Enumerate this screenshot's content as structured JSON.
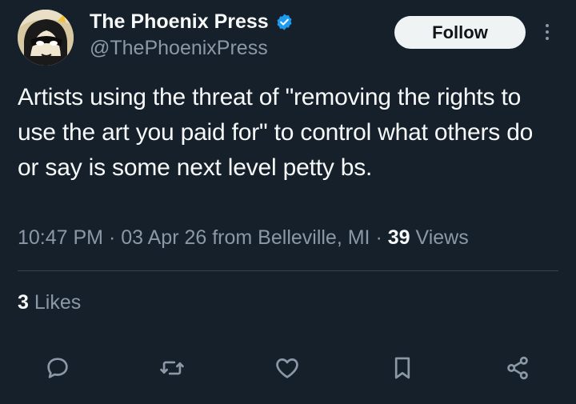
{
  "author": {
    "display_name": "The Phoenix Press",
    "handle": "@ThePhoenixPress",
    "verified_icon": "verified-badge-icon",
    "avatar_icon": "cartoon-masked-face-avatar"
  },
  "follow_button": {
    "label": "Follow"
  },
  "more_menu": {
    "icon": "vertical-dots-icon"
  },
  "tweet": {
    "text": "Artists using the threat of \"removing the rights to use the art you paid for\" to control what others do or say is some next level petty bs."
  },
  "meta": {
    "time": "10:47 PM",
    "date": "03 Apr 26",
    "location": "from Belleville, MI",
    "separator": "·",
    "views_count": "39",
    "views_label": "Views"
  },
  "engagement": {
    "likes_count": "3",
    "likes_label": "Likes"
  },
  "actions": [
    {
      "name": "reply",
      "icon": "speech-bubble-icon"
    },
    {
      "name": "repost",
      "icon": "repost-arrows-icon"
    },
    {
      "name": "like",
      "icon": "heart-icon"
    },
    {
      "name": "bookmark",
      "icon": "bookmark-icon"
    },
    {
      "name": "share",
      "icon": "share-nodes-icon"
    }
  ],
  "colors": {
    "background": "#15202b",
    "primary_text": "#f7f9f9",
    "secondary_text": "#8b98a5",
    "divider": "#38444d",
    "verified": "#1d9bf0",
    "follow_bg": "#eff3f4"
  }
}
